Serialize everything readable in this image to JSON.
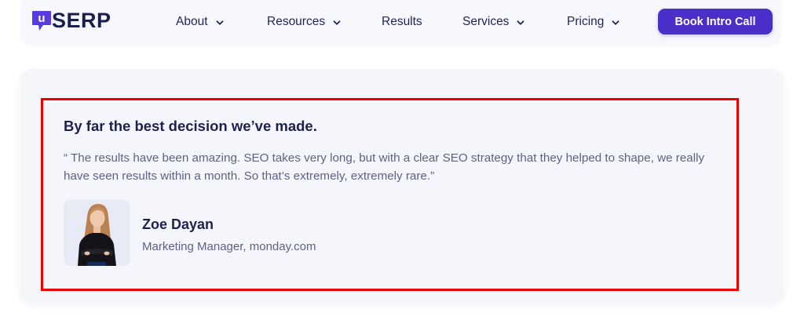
{
  "brand": {
    "logo_letter": "u",
    "logo_text": "SERP",
    "accent_color": "#4a2fc9",
    "text_color": "#1d2150"
  },
  "nav": {
    "items": [
      {
        "label": "About",
        "has_dropdown": true,
        "icon": "chevron-down-icon"
      },
      {
        "label": "Resources",
        "has_dropdown": true,
        "icon": "chevron-down-icon"
      },
      {
        "label": "Results",
        "has_dropdown": false
      },
      {
        "label": "Services",
        "has_dropdown": true,
        "icon": "chevron-down-icon"
      },
      {
        "label": "Pricing",
        "has_dropdown": true,
        "icon": "chevron-down-icon"
      }
    ],
    "cta_label": "Book Intro Call"
  },
  "testimonial": {
    "headline": "By far the best decision we’ve made.",
    "quote": "“ The results have been amazing. SEO takes very long, but with a clear SEO strategy that they helped to shape, we really have seen results within a month. So that’s extremely, extremely rare.”",
    "author_name": "Zoe Dayan",
    "author_role": "Marketing Manager, monday.com",
    "highlight_color": "#ee0000"
  }
}
